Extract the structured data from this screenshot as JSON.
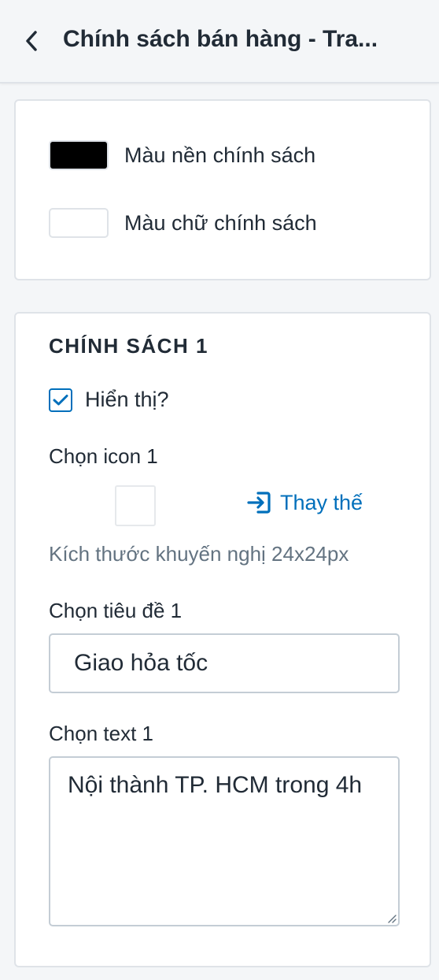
{
  "header": {
    "title": "Chính sách bán hàng - Tra...",
    "back_icon": "chevron-left-icon"
  },
  "colors_card": {
    "background_color": {
      "label": "Màu nền chính sách",
      "value": "#000000"
    },
    "text_color": {
      "label": "Màu chữ chính sách",
      "value": "#ffffff"
    }
  },
  "policy_1": {
    "section_title": "CHÍNH SÁCH 1",
    "show_checkbox": {
      "label": "Hiển thị?",
      "checked": true
    },
    "icon_field": {
      "label": "Chọn icon 1",
      "replace_label": "Thay thế",
      "replace_icon": "replace-import-icon",
      "hint": "Kích thước khuyến nghị 24x24px"
    },
    "title_field": {
      "label": "Chọn tiêu đề 1",
      "value": "Giao hỏa tốc"
    },
    "text_field": {
      "label": "Chọn text 1",
      "value": "Nội thành TP. HCM trong 4h"
    }
  },
  "theme": {
    "accent": "#006fbb",
    "border": "#c4cdd5",
    "muted_text": "#637381",
    "text": "#212b36",
    "page_bg": "#f4f6f8"
  }
}
